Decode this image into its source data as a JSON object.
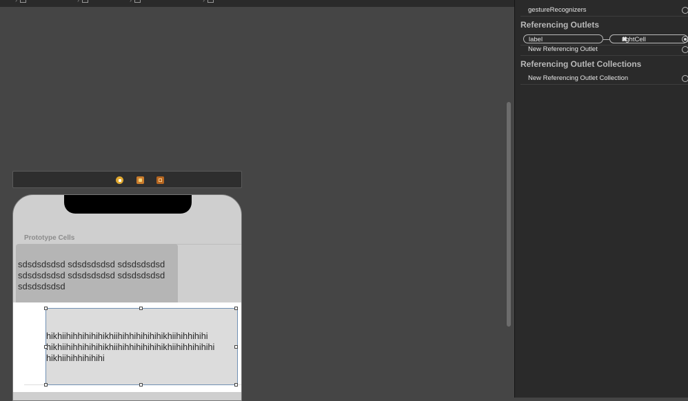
{
  "canvas": {
    "prototype_label": "Prototype Cells",
    "cell1_text": "sdsdsdsdsd sdsdsdsdsd sdsdsdsdsd sdsdsdsdsd sdsdsdsdsd sdsdsdsdsd sdsdsdsdsd",
    "cell2_line1": "hikhiihihhihihihikhiihihhihihihihikhiihihhihihi",
    "cell2_line2": "hikhiihihhihihihikhiihihhihihihihikhiihihhihihihi",
    "cell2_line3": "hikhiihihhihihihi",
    "dock_icons": [
      "view-controller-icon",
      "first-responder-icon",
      "exit-icon"
    ]
  },
  "inspector": {
    "gesture_row": "gestureRecognizers",
    "referencing_outlets_heading": "Referencing Outlets",
    "outlet_source": "label",
    "outlet_target": "rightCell",
    "outlet_remove_glyph": "✖",
    "new_outlet": "New Referencing Outlet",
    "collections_heading": "Referencing Outlet Collections",
    "new_collection": "New Referencing Outlet Collection"
  },
  "colors": {
    "canvas_bg": "#454545",
    "inspector_bg": "#2a2a2a",
    "selection_border": "#6f8fb3"
  }
}
